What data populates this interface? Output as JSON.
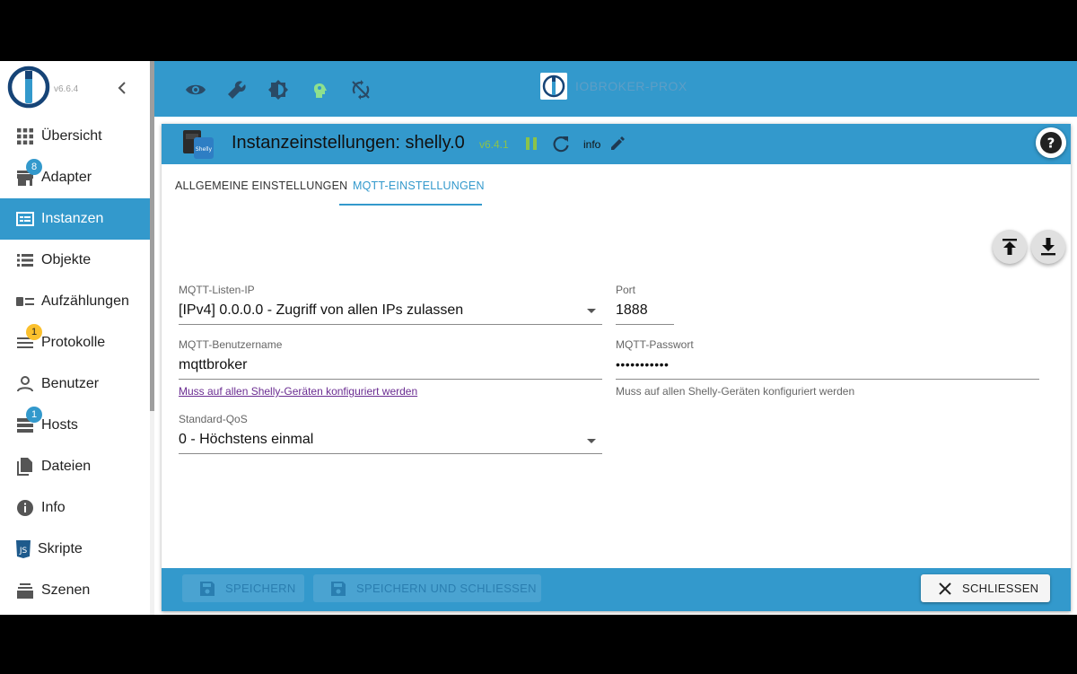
{
  "sidebar": {
    "version": "v6.6.4",
    "items": [
      {
        "label": "Übersicht",
        "icon": "apps-grid-icon"
      },
      {
        "label": "Adapter",
        "icon": "store-icon",
        "badge": "8"
      },
      {
        "label": "Instanzen",
        "icon": "instances-icon",
        "active": true
      },
      {
        "label": "Objekte",
        "icon": "list-icon"
      },
      {
        "label": "Aufzählungen",
        "icon": "enum-icon"
      },
      {
        "label": "Protokolle",
        "icon": "log-lines-icon",
        "badge": "1"
      },
      {
        "label": "Benutzer",
        "icon": "person-icon"
      },
      {
        "label": "Hosts",
        "icon": "storage-icon",
        "badge": "1"
      },
      {
        "label": "Dateien",
        "icon": "files-icon"
      },
      {
        "label": "Info",
        "icon": "info-icon"
      },
      {
        "label": "Skripte",
        "icon": "javascript-icon"
      },
      {
        "label": "Szenen",
        "icon": "scenes-icon"
      }
    ]
  },
  "topbar": {
    "host_name": "IOBROKER-PROX",
    "icons": [
      "eye-icon",
      "wrench-icon",
      "brightness-icon",
      "expert-head-icon",
      "sync-disabled-icon"
    ]
  },
  "dialog": {
    "title": "Instanzeinstellungen: shelly.0",
    "version": "v6.4.1",
    "log_level": "info",
    "tabs": [
      "ALLGEMEINE EINSTELLUNGEN",
      "MQTT-EINSTELLUNGEN"
    ],
    "active_tab": "MQTT-EINSTELLUNGEN",
    "fields": {
      "listen_ip": {
        "label": "MQTT-Listen-IP",
        "value": "[IPv4] 0.0.0.0 - Zugriff von allen IPs zulassen"
      },
      "port": {
        "label": "Port",
        "value": "1888"
      },
      "username": {
        "label": "MQTT-Benutzername",
        "value": "mqttbroker",
        "helper": "Muss auf allen Shelly-Geräten konfiguriert werden"
      },
      "password": {
        "label": "MQTT-Passwort",
        "value": "•••••••••••",
        "helper": "Muss auf allen Shelly-Geräten konfiguriert werden"
      },
      "qos": {
        "label": "Standard-QoS",
        "value": "0 - Höchstens einmal"
      }
    },
    "footer": {
      "save": "SPEICHERN",
      "save_close": "SPEICHERN UND SCHLIESSEN",
      "close": "SCHLIESSEN"
    }
  },
  "colors": {
    "accent": "#3399cc",
    "badge_blue": "#3399cc",
    "badge_yellow": "#fbc02d",
    "version_green": "#8bc34a",
    "link_purple": "#6a2c91"
  }
}
